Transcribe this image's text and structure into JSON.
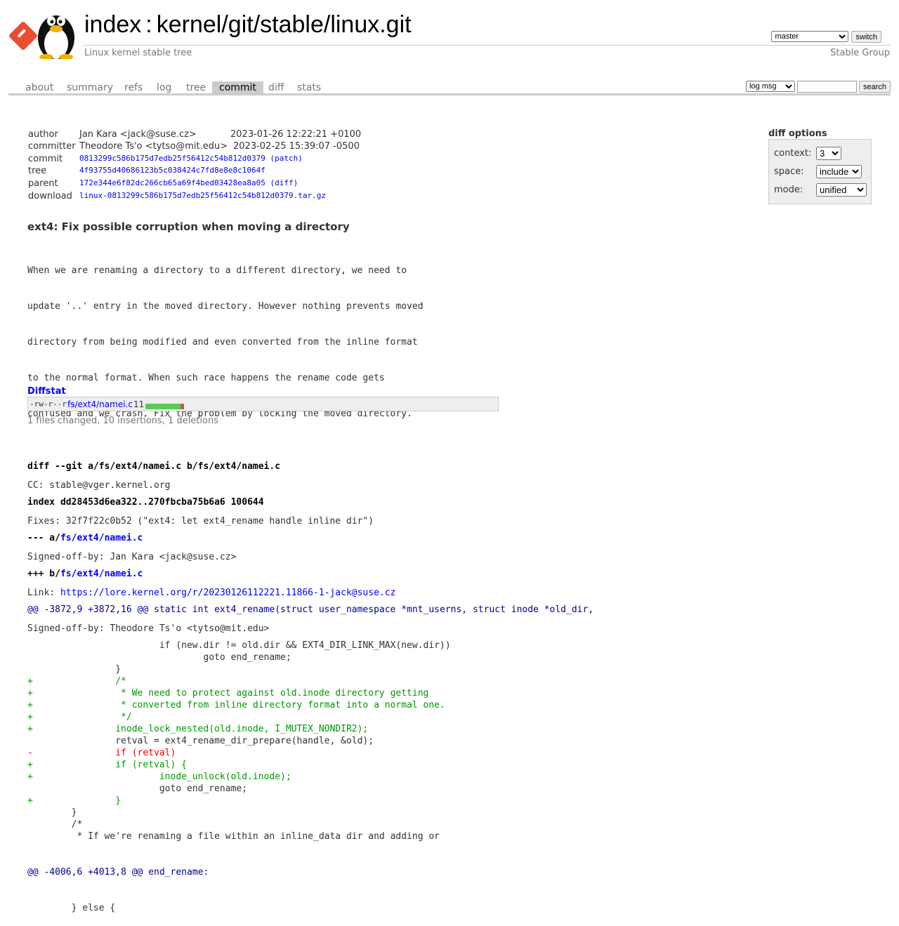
{
  "header": {
    "title_prefix": "index",
    "title_sep": ":",
    "title_repo": "kernel/git/stable/linux.git",
    "subtitle": "Linux kernel stable tree",
    "owner": "Stable Group",
    "branch_value": "master",
    "switch_label": "switch"
  },
  "tabs": [
    {
      "label": "about"
    },
    {
      "label": "summary"
    },
    {
      "label": "refs"
    },
    {
      "label": "log"
    },
    {
      "label": "tree"
    },
    {
      "label": "commit"
    },
    {
      "label": "diff"
    },
    {
      "label": "stats"
    }
  ],
  "search": {
    "grep_value": "log msg",
    "button_label": "search"
  },
  "commit_info": {
    "author_label": "author",
    "author": "Jan Kara <jack@suse.cz>",
    "author_date": "2023-01-26 12:22:21 +0100",
    "committer_label": "committer",
    "committer": "Theodore Ts'o <tytso@mit.edu>",
    "committer_date": "2023-02-25 15:39:07 -0500",
    "commit_label": "commit",
    "commit": "0813299c586b175d7edb25f56412c54b812d0379",
    "commit_link": "(patch)",
    "tree_label": "tree",
    "tree": "4f93755d40686123b5c038424c7fd8e8e8c1064f",
    "parent_label": "parent",
    "parent": "172e344e6f82dc266cb65a69f4bed03428ea8a05",
    "parent_link": "(diff)",
    "download_label": "download",
    "download": "linux-0813299c586b175d7edb25f56412c54b812d0379.tar.gz"
  },
  "diff_options": {
    "title": "diff options",
    "context_label": "context:",
    "context_value": "3",
    "space_label": "space:",
    "space_value": "include",
    "mode_label": "mode:",
    "mode_value": "unified"
  },
  "commit_subject": "ext4: Fix possible corruption when moving a directory",
  "commit_message": [
    "When we are renaming a directory to a different directory, we need to",
    "update '..' entry in the moved directory. However nothing prevents moved",
    "directory from being modified and even converted from the inline format",
    "to the normal format. When such race happens the rename code gets",
    "confused and we crash. Fix the problem by locking the moved directory.",
    "",
    "CC: stable@vger.kernel.org",
    "Fixes: 32f7f22c0b52 (\"ext4: let ext4_rename handle inline dir\")",
    "Signed-off-by: Jan Kara <jack@suse.cz>",
    "Link: ",
    "Signed-off-by: Theodore Ts'o <tytso@mit.edu>"
  ],
  "commit_link_url": "https://lore.kernel.org/r/20230126112221.11866-1-jack@suse.cz",
  "diffstat": {
    "heading": "Diffstat",
    "mode": "-rw-r--r--",
    "file": "fs/ext4/namei.c",
    "changes": "11",
    "insertions_fraction": 0.909,
    "summary": "1 files changed, 10 insertions, 1 deletions"
  },
  "diff": {
    "line1": "diff --git a/fs/ext4/namei.c b/fs/ext4/namei.c",
    "line2": "index dd28453d6ea322..270fbcba75b6a6 100644",
    "line3_prefix": "--- a/",
    "line3_file": "fs/ext4/namei.c",
    "line4_prefix": "+++ b/",
    "line4_file": "fs/ext4/namei.c",
    "hunk1": "@@ -3872,9 +3872,16 @@",
    "hunk1_fn": " static int ext4_rename(struct user_namespace *mnt_userns, struct inode *old_dir,",
    "lines": [
      {
        "type": "ctx",
        "text": " \t\t\tif (new.dir != old.dir && EXT4_DIR_LINK_MAX(new.dir))"
      },
      {
        "type": "ctx",
        "text": " \t\t\t\tgoto end_rename;"
      },
      {
        "type": "ctx",
        "text": " \t\t}"
      },
      {
        "type": "add",
        "text": "+\t\t/*"
      },
      {
        "type": "add",
        "text": "+\t\t * We need to protect against old.inode directory getting"
      },
      {
        "type": "add",
        "text": "+\t\t * converted from inline directory format into a normal one."
      },
      {
        "type": "add",
        "text": "+\t\t */"
      },
      {
        "type": "add",
        "text": "+\t\tinode_lock_nested(old.inode, I_MUTEX_NONDIR2);"
      },
      {
        "type": "ctx",
        "text": " \t\tretval = ext4_rename_dir_prepare(handle, &old);"
      },
      {
        "type": "del",
        "text": "-\t\tif (retval)"
      },
      {
        "type": "add",
        "text": "+\t\tif (retval) {"
      },
      {
        "type": "add",
        "text": "+\t\t\tinode_unlock(old.inode);"
      },
      {
        "type": "ctx",
        "text": " \t\t\tgoto end_rename;"
      },
      {
        "type": "add",
        "text": "+\t\t}"
      },
      {
        "type": "ctx",
        "text": " \t}"
      },
      {
        "type": "ctx",
        "text": " \t/*"
      },
      {
        "type": "ctx",
        "text": " \t * If we're renaming a file within an inline_data dir and adding or"
      }
    ],
    "hunk2": "@@ -4006,6 +4013,8 @@",
    "hunk2_fn": " end_rename:",
    "tail_line": " \t} else {"
  }
}
